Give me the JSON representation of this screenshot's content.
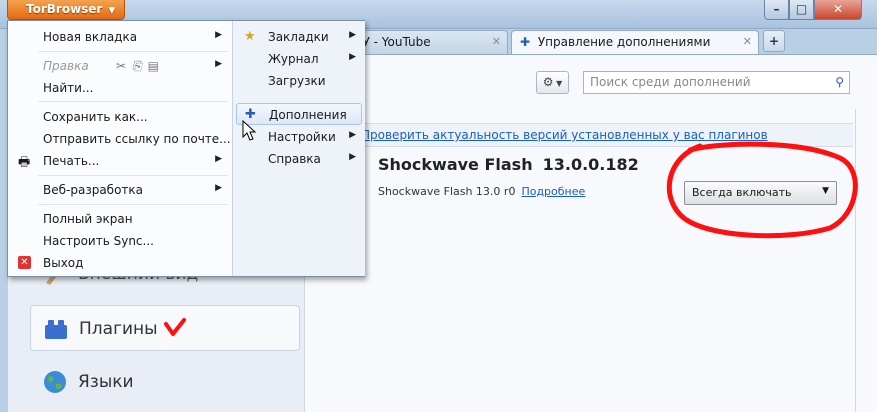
{
  "app_button": {
    "label": "TorBrowser"
  },
  "window_controls": {
    "minimize": "–",
    "maximize": "□",
    "close": "✕"
  },
  "tabs": [
    {
      "label": "АФУ - YouTube",
      "active": false
    },
    {
      "label": "Управление дополнениями",
      "active": true
    }
  ],
  "new_tab": {
    "label": "+"
  },
  "toolbar": {
    "search_placeholder": "Поиск среди дополнений"
  },
  "sidebar": {
    "items": [
      {
        "label": "Внешний вид"
      },
      {
        "label": "Плагины"
      },
      {
        "label": "Языки"
      }
    ]
  },
  "main": {
    "update_link": "Проверить актуальность версий установленных у вас плагинов",
    "addon": {
      "name": "Shockwave Flash",
      "version": "13.0.0.182",
      "description": "Shockwave Flash 13.0 r0",
      "more_link": "Подробнее",
      "state": "Всегда включать"
    }
  },
  "menu": {
    "left": {
      "new_tab": "Новая вкладка",
      "edit": "Правка",
      "find": "Найти...",
      "save_as": "Сохранить как...",
      "send_link": "Отправить ссылку по почте...",
      "print": "Печать...",
      "web_dev": "Веб-разработка",
      "fullscreen": "Полный экран",
      "sync": "Настроить Sync...",
      "exit": "Выход"
    },
    "right": {
      "bookmarks": "Закладки",
      "history": "Журнал",
      "downloads": "Загрузки",
      "addons": "Дополнения",
      "settings": "Настройки",
      "help": "Справка"
    }
  },
  "colors": {
    "accent_orange": "#e56a12",
    "annotation_red": "#ff0000",
    "link_blue": "#1a5cc8"
  }
}
